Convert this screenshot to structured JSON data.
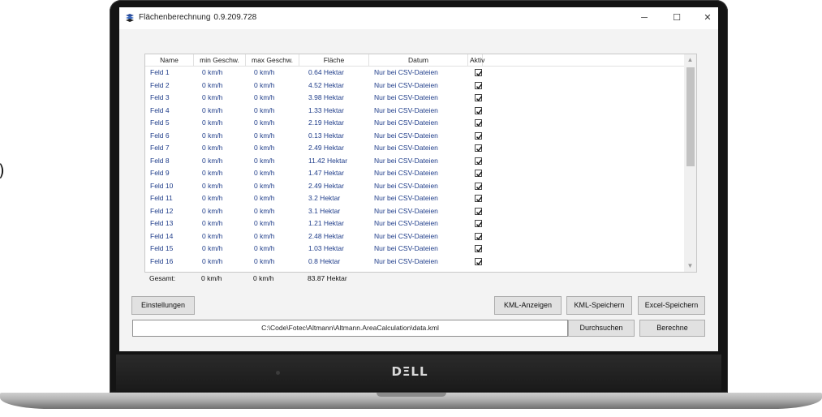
{
  "stray_text": ")",
  "window": {
    "title": "Flächenberechnung",
    "version": "0.9.209.728",
    "controls": {
      "minimize": "─",
      "maximize": "☐",
      "close": "✕"
    }
  },
  "table": {
    "columns": [
      "Name",
      "min Geschw.",
      "max Geschw.",
      "Fläche",
      "Datum",
      "Aktiv"
    ],
    "rows": [
      {
        "name": "Feld 1",
        "min": "0 km/h",
        "max": "0 km/h",
        "area": "0.64 Hektar",
        "date": "Nur bei CSV-Dateien",
        "active": true
      },
      {
        "name": "Feld 2",
        "min": "0 km/h",
        "max": "0 km/h",
        "area": "4.52 Hektar",
        "date": "Nur bei CSV-Dateien",
        "active": true
      },
      {
        "name": "Feld 3",
        "min": "0 km/h",
        "max": "0 km/h",
        "area": "3.98 Hektar",
        "date": "Nur bei CSV-Dateien",
        "active": true
      },
      {
        "name": "Feld 4",
        "min": "0 km/h",
        "max": "0 km/h",
        "area": "1.33 Hektar",
        "date": "Nur bei CSV-Dateien",
        "active": true
      },
      {
        "name": "Feld 5",
        "min": "0 km/h",
        "max": "0 km/h",
        "area": "2.19 Hektar",
        "date": "Nur bei CSV-Dateien",
        "active": true
      },
      {
        "name": "Feld 6",
        "min": "0 km/h",
        "max": "0 km/h",
        "area": "0.13 Hektar",
        "date": "Nur bei CSV-Dateien",
        "active": true
      },
      {
        "name": "Feld 7",
        "min": "0 km/h",
        "max": "0 km/h",
        "area": "2.49 Hektar",
        "date": "Nur bei CSV-Dateien",
        "active": true
      },
      {
        "name": "Feld 8",
        "min": "0 km/h",
        "max": "0 km/h",
        "area": "11.42 Hektar",
        "date": "Nur bei CSV-Dateien",
        "active": true
      },
      {
        "name": "Feld 9",
        "min": "0 km/h",
        "max": "0 km/h",
        "area": "1.47 Hektar",
        "date": "Nur bei CSV-Dateien",
        "active": true
      },
      {
        "name": "Feld 10",
        "min": "0 km/h",
        "max": "0 km/h",
        "area": "2.49 Hektar",
        "date": "Nur bei CSV-Dateien",
        "active": true
      },
      {
        "name": "Feld 11",
        "min": "0 km/h",
        "max": "0 km/h",
        "area": "3.2 Hektar",
        "date": "Nur bei CSV-Dateien",
        "active": true
      },
      {
        "name": "Feld 12",
        "min": "0 km/h",
        "max": "0 km/h",
        "area": "3.1 Hektar",
        "date": "Nur bei CSV-Dateien",
        "active": true
      },
      {
        "name": "Feld 13",
        "min": "0 km/h",
        "max": "0 km/h",
        "area": "1.21 Hektar",
        "date": "Nur bei CSV-Dateien",
        "active": true
      },
      {
        "name": "Feld 14",
        "min": "0 km/h",
        "max": "0 km/h",
        "area": "2.48 Hektar",
        "date": "Nur bei CSV-Dateien",
        "active": true
      },
      {
        "name": "Feld 15",
        "min": "0 km/h",
        "max": "0 km/h",
        "area": "1.03 Hektar",
        "date": "Nur bei CSV-Dateien",
        "active": true
      },
      {
        "name": "Feld 16",
        "min": "0 km/h",
        "max": "0 km/h",
        "area": "0.8 Hektar",
        "date": "Nur bei CSV-Dateien",
        "active": true
      }
    ],
    "scroll": {
      "up_arrow": "▲",
      "down_arrow": "▼"
    }
  },
  "totals": {
    "label": "Gesamt:",
    "min": "0 km/h",
    "max": "0 km/h",
    "area": "83.87 Hektar"
  },
  "buttons": {
    "settings": "Einstellungen",
    "kml_show": "KML-Anzeigen",
    "kml_save": "KML-Speichern",
    "excel_save": "Excel-Speichern",
    "browse": "Durchsuchen",
    "calculate": "Berechne"
  },
  "path": {
    "value": "C:\\Code\\Fotec\\Altmann\\Altmann.AreaCalculation\\data.kml"
  },
  "laptop": {
    "brand": "DΞLL"
  },
  "colors": {
    "row_text": "#1f3d8a",
    "window_bg": "#f3f3f3",
    "bezel": "#141414"
  }
}
